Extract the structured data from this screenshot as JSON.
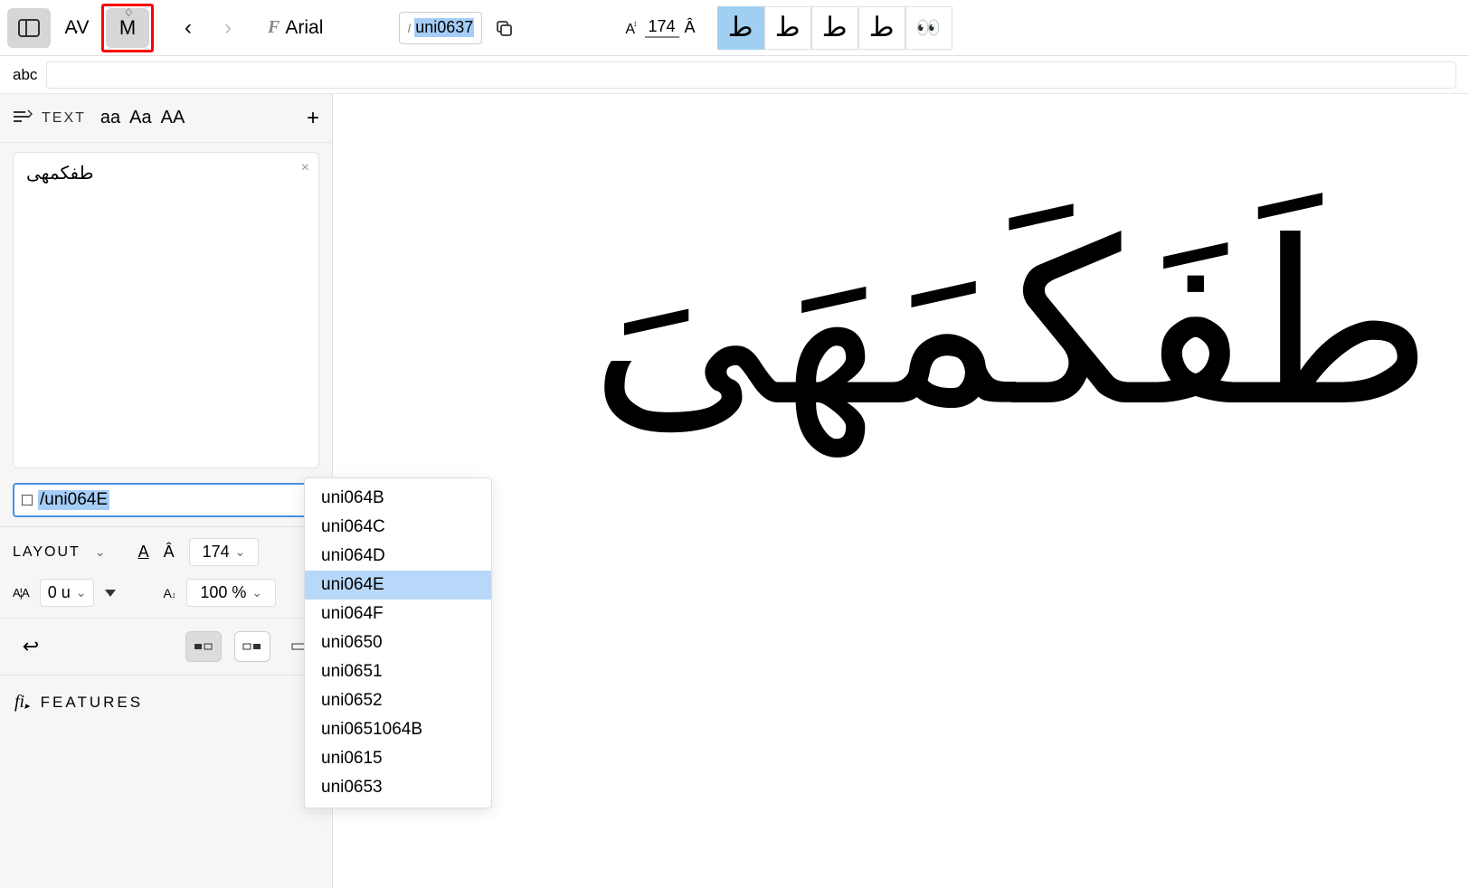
{
  "toolbar": {
    "font_icon_label": "F",
    "font_name": "Arial",
    "glyph_slash": "I",
    "glyph_name": "uni0637",
    "size_letter": "A",
    "size_value": "174",
    "a_hat": "Â",
    "variants": [
      "ط",
      "ط",
      "ط",
      "ط"
    ]
  },
  "subbar": {
    "label": "abc"
  },
  "sidebar": {
    "text_label": "TEXT",
    "case_aa": "aa",
    "case_Aa": "Aa",
    "case_AA": "AA",
    "card_text": "طفكمهى",
    "glyph_input": "/uni064E",
    "layout_label": "LAYOUT",
    "layout_a1": "A",
    "layout_a2": "Â",
    "layout_size": "174",
    "kern_label": "A¦A",
    "kern_value": "0 u",
    "scale_icon": "A",
    "scale_value": "100 %",
    "features_label": "FEATURES"
  },
  "dropdown": {
    "items": [
      "uni064B",
      "uni064C",
      "uni064D",
      "uni064E",
      "uni064F",
      "uni0650",
      "uni0651",
      "uni0652",
      "uni0651064B",
      "uni0615",
      "uni0653"
    ],
    "selected": "uni064E"
  },
  "canvas": {
    "text": "طَفَكَمَهَىَ"
  }
}
